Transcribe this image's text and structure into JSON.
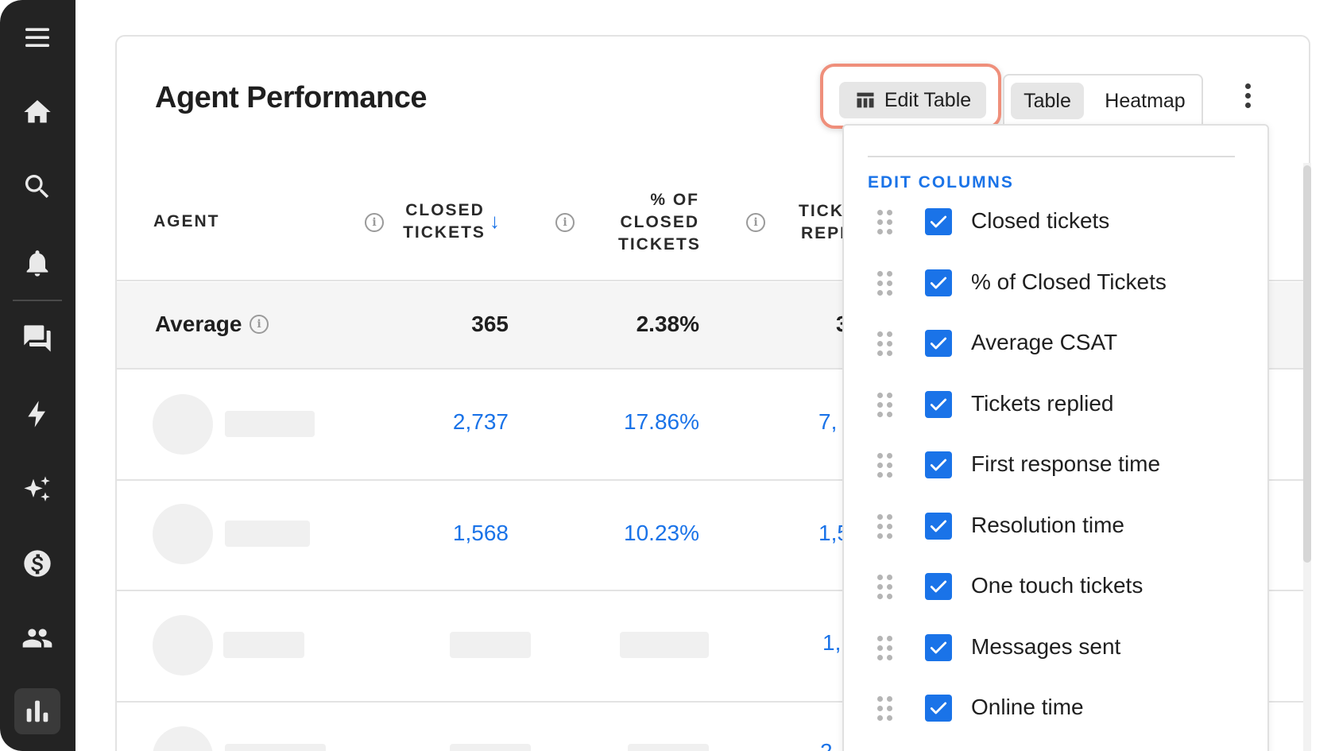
{
  "page": {
    "title": "Agent Performance"
  },
  "toolbar": {
    "edit_label": "Edit Table",
    "view_table": "Table",
    "view_heatmap": "Heatmap"
  },
  "sidebar": {
    "items": [
      "menu-icon",
      "home-icon",
      "search-icon",
      "bell-icon",
      "chat-icon",
      "bolt-icon",
      "sparkles-icon",
      "dollar-icon",
      "users-icon",
      "chart-icon"
    ],
    "active": "chart-icon"
  },
  "table": {
    "headers": {
      "agent": "AGENT",
      "closed_1": "CLOSED",
      "closed_2": "TICKETS",
      "pct_1": "% OF",
      "pct_2": "CLOSED",
      "pct_3": "TICKETS",
      "tick_1": "TICK",
      "tick_2": "REPI"
    },
    "average": {
      "label": "Average",
      "closed": "365",
      "pct": "2.38%",
      "next": "3"
    },
    "rows": [
      {
        "closed": "2,737",
        "pct": "17.86%",
        "next": "7,"
      },
      {
        "closed": "1,568",
        "pct": "10.23%",
        "next": "1,5"
      },
      {
        "closed": "",
        "pct": "",
        "next": "1,"
      },
      {
        "closed": "",
        "pct": "",
        "next": "2"
      }
    ]
  },
  "dropdown": {
    "heading": "EDIT COLUMNS",
    "items": [
      {
        "label": "Closed tickets",
        "checked": true
      },
      {
        "label": "% of Closed Tickets",
        "checked": true
      },
      {
        "label": "Average CSAT",
        "checked": true
      },
      {
        "label": "Tickets replied",
        "checked": true
      },
      {
        "label": "First response time",
        "checked": true
      },
      {
        "label": "Resolution time",
        "checked": true
      },
      {
        "label": "One touch tickets",
        "checked": true
      },
      {
        "label": "Messages sent",
        "checked": true
      },
      {
        "label": "Online time",
        "checked": true
      }
    ]
  },
  "colors": {
    "accent": "#1a73e8",
    "highlight": "#ef8f7b",
    "sidebar": "#232323"
  }
}
